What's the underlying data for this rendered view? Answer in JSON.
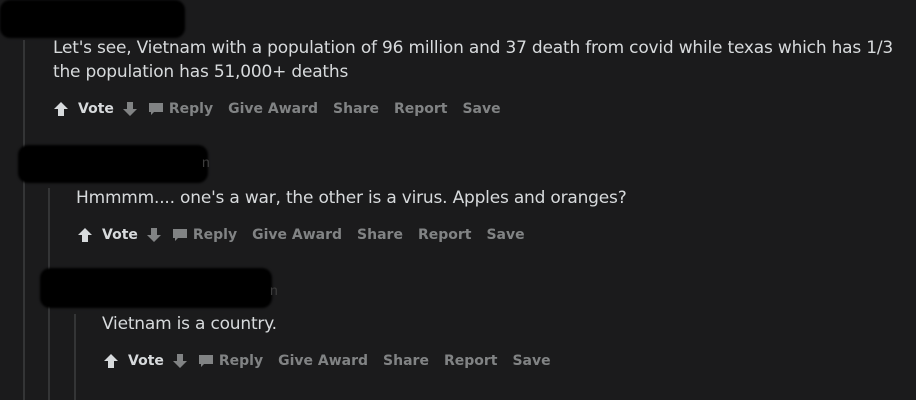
{
  "comments": [
    {
      "body_line1": "Let's see, Vietnam with a population of 96 million and 37 death from covid while texas which has 1/3",
      "body_line2": "the population has 51,000+ deaths",
      "actions": {
        "vote": "Vote",
        "reply": "Reply",
        "give_award": "Give Award",
        "share": "Share",
        "report": "Report",
        "save": "Save"
      }
    },
    {
      "header_hint": "n",
      "body_line1": "Hmmmm.... one's a war, the other is a virus. Apples and oranges?",
      "actions": {
        "vote": "Vote",
        "reply": "Reply",
        "give_award": "Give Award",
        "share": "Share",
        "report": "Report",
        "save": "Save"
      }
    },
    {
      "header_hint": "n",
      "body_line1": "Vietnam is a country.",
      "actions": {
        "vote": "Vote",
        "reply": "Reply",
        "give_award": "Give Award",
        "share": "Share",
        "report": "Report",
        "save": "Save"
      }
    }
  ],
  "icons": {
    "upvote": "upvote-arrow-icon",
    "downvote": "downvote-arrow-icon",
    "reply": "speech-bubble-icon"
  },
  "colors": {
    "background": "#1b1b1c",
    "text": "#d7dadc",
    "muted": "#818384",
    "thread_line": "#343536"
  }
}
